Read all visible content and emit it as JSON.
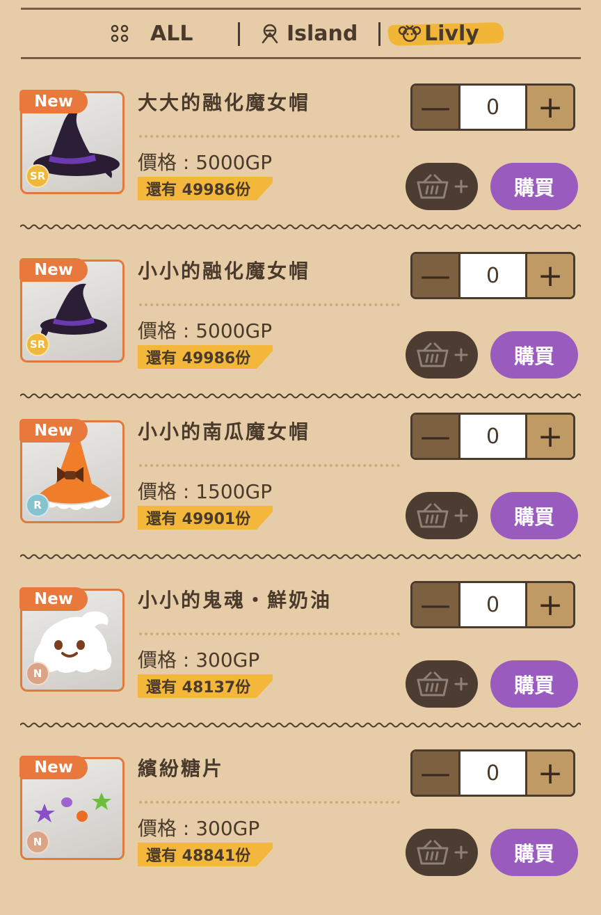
{
  "tabs": {
    "all": "ALL",
    "island": "Island",
    "livly": "Livly"
  },
  "items": [
    {
      "name": "大大的融化魔女帽",
      "price": "價格 : 5000GP",
      "stock": "還有 49986份",
      "rarity": "SR",
      "badge": "New",
      "qty": "0",
      "buy": "購買"
    },
    {
      "name": "小小的融化魔女帽",
      "price": "價格 : 5000GP",
      "stock": "還有 49986份",
      "rarity": "SR",
      "badge": "New",
      "qty": "0",
      "buy": "購買"
    },
    {
      "name": "小小的南瓜魔女帽",
      "price": "價格 : 1500GP",
      "stock": "還有 49901份",
      "rarity": "R",
      "badge": "New",
      "qty": "0",
      "buy": "購買"
    },
    {
      "name": "小小的鬼魂・鮮奶油",
      "price": "價格 : 300GP",
      "stock": "還有 48137份",
      "rarity": "N",
      "badge": "New",
      "qty": "0",
      "buy": "購買"
    },
    {
      "name": "繽紛糖片",
      "price": "價格 : 300GP",
      "stock": "還有 48841份",
      "rarity": "N",
      "badge": "New",
      "qty": "0",
      "buy": "購買"
    }
  ],
  "colors": {
    "background": "#e6cda7",
    "accent_orange": "#e8783b",
    "buy_purple": "#9a5bbf",
    "stock_yellow": "#f2b73b",
    "rarity_sr": "#f0b83a",
    "rarity_r": "#86c3cf",
    "rarity_n": "#dba486"
  }
}
